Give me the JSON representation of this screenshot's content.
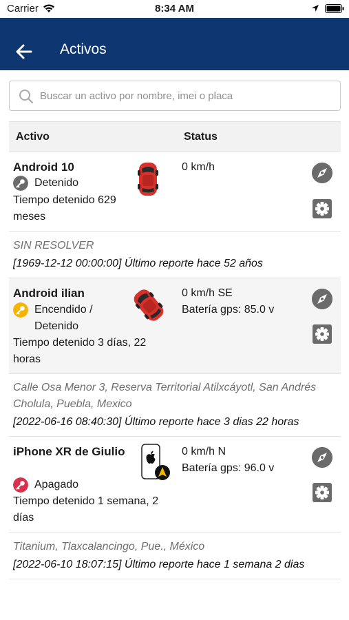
{
  "status_bar": {
    "carrier": "Carrier",
    "time": "8:34 AM"
  },
  "header": {
    "title": "Activos"
  },
  "search": {
    "placeholder": "Buscar un activo por nombre, imei o placa"
  },
  "table": {
    "col_asset": "Activo",
    "col_status": "Status"
  },
  "assets": [
    {
      "name": "Android 10",
      "state": "Detenido",
      "key_color": "#6b6b6b",
      "stopped": "Tiempo detenido 629 meses",
      "status_lines": [
        "0 km/h"
      ],
      "address": "SIN RESOLVER",
      "report": "[1969-12-12 00:00:00] Último reporte hace 52 años"
    },
    {
      "name": "Android ilian",
      "state": "Encendido / Detenido",
      "key_color": "#f4b400",
      "stopped": "Tiempo detenido 3 días, 22 horas",
      "status_lines": [
        "0 km/h SE",
        "Batería gps: 85.0 v"
      ],
      "address": "Calle Osa Menor 3, Reserva Territorial Atilxcáyotl, San Andrés Cholula, Puebla, Mexico",
      "report": "[2022-06-16 08:40:30] Último reporte hace 3 dias 22 horas"
    },
    {
      "name": "iPhone XR de Giulio",
      "state": "Apagado",
      "key_color": "#d9304e",
      "stopped": "Tiempo detenido 1 semana, 2 días",
      "status_lines": [
        "0 km/h N",
        "Batería gps: 96.0 v"
      ],
      "address": "Titanium, Tlaxcalancingo, Pue., México",
      "report": "[2022-06-10 18:07:15] Último reporte hace 1 semana 2 dias"
    }
  ],
  "icons": {
    "back": "arrow-left-icon",
    "search": "search-icon",
    "navigate": "compass-icon",
    "settings": "gear-icon",
    "key": "key-icon"
  }
}
